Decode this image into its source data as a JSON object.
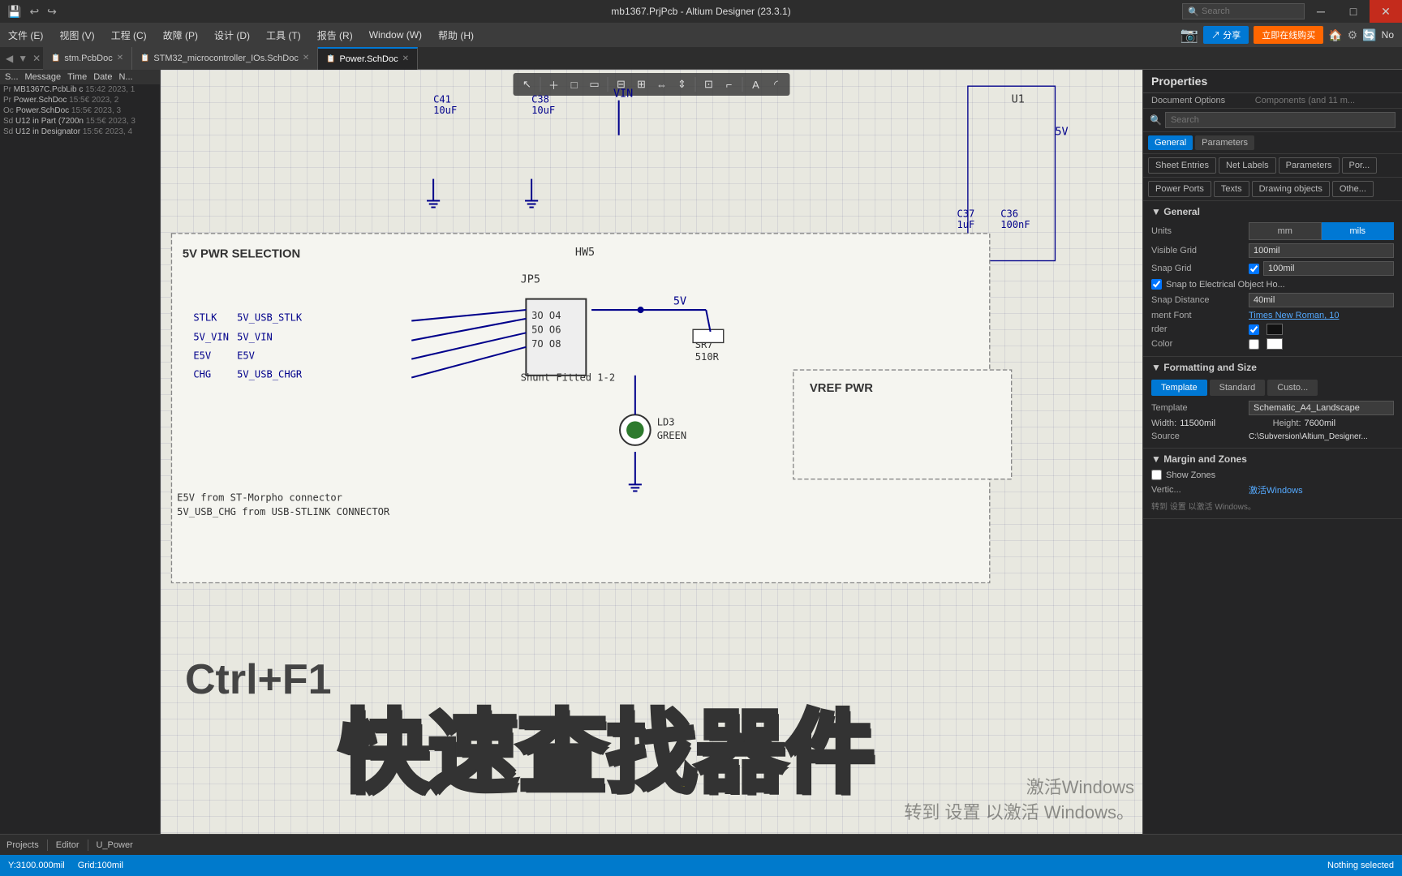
{
  "window": {
    "title": "mb1367.PrjPcb - Altium Designer (23.3.1)",
    "minimize": "─",
    "maximize": "□",
    "close": "✕"
  },
  "titlebar": {
    "icons": [
      "💾",
      "↩",
      "↪"
    ],
    "search_placeholder": "Search"
  },
  "menubar": {
    "items": [
      "文件 (E)",
      "视图 (V)",
      "工程 (C)",
      "故障 (P)",
      "设计 (D)",
      "工具 (T)",
      "报告 (R)",
      "Window (W)",
      "帮助 (H)"
    ],
    "right": {
      "share": "↗ 分享",
      "online": "立即在线购买"
    }
  },
  "tabs": [
    {
      "label": "stm.PcbDoc",
      "active": false,
      "modified": true
    },
    {
      "label": "STM32_microcontroller_IOs.SchDoc",
      "active": false,
      "modified": true
    },
    {
      "label": "Power.SchDoc",
      "active": true,
      "modified": false
    }
  ],
  "left_panel": {
    "headers": [
      "S...",
      "Message",
      "Time",
      "Date",
      "N..."
    ],
    "messages": [
      {
        "prefix": "Pr",
        "text": "MB1367C.PcbLib c",
        "time": "15:42",
        "year": "2023,",
        "num": "1"
      },
      {
        "prefix": "Pr",
        "text": "Power.SchDoc",
        "time": "15:56",
        "year": "2023,",
        "num": "2"
      },
      {
        "prefix": "Oc",
        "text": "Power.SchDoc",
        "time": "15:56",
        "year": "2023,",
        "num": "3"
      },
      {
        "prefix": "Sd",
        "text": "U12 in Part (7200n",
        "time": "15:5€",
        "year": "2023,",
        "num": "3"
      },
      {
        "prefix": "Sd",
        "text": "U12 in Designator",
        "time": "15:5€",
        "year": "2023,",
        "num": "4"
      }
    ]
  },
  "schematic": {
    "section1": {
      "label": "5V PWR SELECTION",
      "component_label": "HW5",
      "jp5": "JP5",
      "connections": [
        "STLK",
        "5V_VIN",
        "E5V",
        "CHG"
      ],
      "net_labels": [
        "5V_USB_STLK",
        "5V_VIN",
        "E5V",
        "5V_USB_CHGR"
      ],
      "connector": [
        "3O O4",
        "5O O6",
        "7O O8"
      ],
      "shunt": "Shunt Fitted 1-2",
      "resistor": "SR7\n510R",
      "led": "LD3\nGREEN",
      "note1": "E5V from ST-Morpho connector",
      "note2": "5V_USB_CHG from USB-STLINK CONNECTOR",
      "net_5v": "5V"
    },
    "section2": {
      "label": "VREF PWR"
    },
    "caps": [
      "C41\n10uF",
      "C38\n10uF",
      "C37\n1uF",
      "C36\n100nF"
    ],
    "ref": "U1"
  },
  "overlay": {
    "chinese_text": "快速查找器件",
    "shortcut": "Ctrl+F1"
  },
  "properties": {
    "title": "Properties",
    "subtitle": "Document Options",
    "subtitle2": "Components (and 11 m...",
    "search_placeholder": "Search",
    "tabs_row1": [
      "General",
      "Parameters"
    ],
    "tabs_row2": [
      "Sheet Entries",
      "Net Labels",
      "Parameters",
      "Por..."
    ],
    "tabs_row3": [
      "Power Ports",
      "Texts",
      "Drawing objects",
      "Othe..."
    ],
    "general": {
      "title": "General",
      "units_label": "Units",
      "units": [
        "mm",
        "mils"
      ],
      "units_active": "mils",
      "visible_grid_label": "Visible Grid",
      "visible_grid_value": "100mil",
      "snap_grid_label": "Snap Grid",
      "snap_grid_value": "100mil",
      "snap_electrical_label": "Snap to Electrical Object Ho...",
      "snap_distance_label": "Snap Distance",
      "snap_distance_value": "40mil",
      "component_font_label": "ment Font",
      "component_font_value": "Times New Roman, 10",
      "border_label": "rder",
      "border_checked": true,
      "color_label": "Color",
      "color_checked": false
    },
    "formatting_size": {
      "title": "Formatting and Size",
      "tabs": [
        "Template",
        "Standard",
        "Custo..."
      ],
      "active_tab": "Template",
      "template_label": "Template",
      "template_value": "Schematic_A4_Landscape",
      "width_label": "Width:",
      "width_value": "11500mil",
      "height_label": "Height:",
      "height_value": "7600mil",
      "source_label": "Source",
      "source_value": "C:\\Subversion\\Altium_Designer..."
    },
    "margin_zones": {
      "title": "Margin and Zones",
      "show_zones_label": "Show Zones",
      "show_zones_checked": false,
      "vertical_label": "Vertic..."
    }
  },
  "bottom_toolbar": {
    "projects": "Projects",
    "editor": "Editor",
    "u_power": "U_Power"
  },
  "statusbar": {
    "coords": "Y:3100.000mil",
    "grid": "Grid:100mil",
    "selection": "Nothing selected"
  },
  "win_activate": {
    "line1": "激活Windows",
    "line2": "转到 设置 以激活 Windows。"
  }
}
